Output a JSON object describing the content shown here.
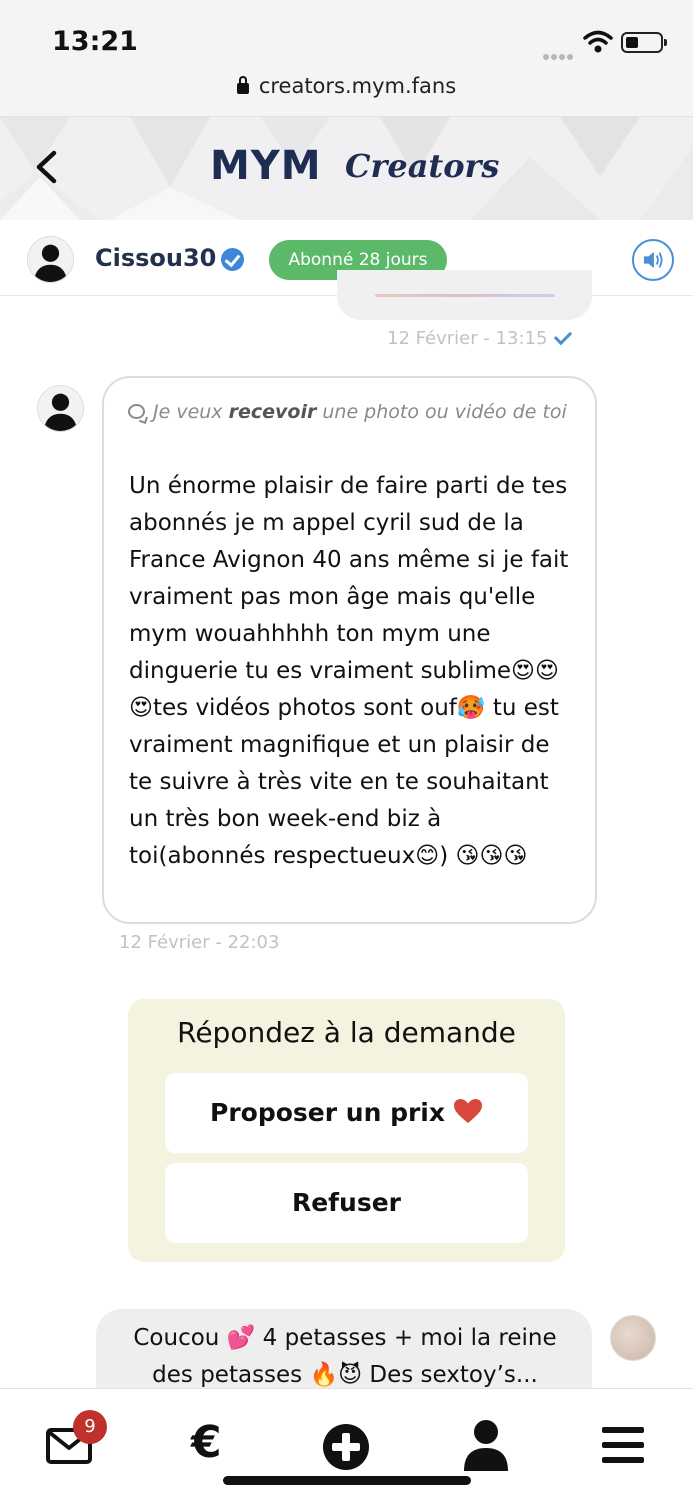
{
  "status_bar": {
    "time": "13:21"
  },
  "browser": {
    "url": "creators.mym.fans"
  },
  "header": {
    "logo_main": "MYM",
    "logo_sub": "Creators",
    "back_icon": "chevron-left-icon"
  },
  "profile": {
    "name": "Cissou30",
    "verified_icon": "verified-check-icon",
    "subscription_badge": "Abonné 28 jours",
    "sound_icon": "speaker-icon",
    "badge_color": "#5cb96a"
  },
  "chat": {
    "previous_timestamp": "12 Février - 13:15",
    "message": {
      "request_prefix": "Je veux ",
      "request_bold": "recevoir",
      "request_suffix": " une photo ou vidéo de toi",
      "text": "Un énorme plaisir de faire parti de tes abonnés je m appel cyril sud de la France Avignon 40 ans même si je fait vraiment pas mon âge mais qu'elle mym wouahhhhh ton mym une dinguerie tu es vraiment sublime😍😍😍tes vidéos photos sont ouf🥵 tu est vraiment magnifique et un plaisir de te suivre à très vite en te souhaitant un très bon week-end biz à toi(abonnés respectueux😊) 😘😘😘",
      "timestamp": "12 Février - 22:03"
    },
    "request_box": {
      "title": "Répondez à la demande",
      "propose_label": "Proposer un prix",
      "refuse_label": "Refuser",
      "heart_color": "#d9473f",
      "background": "#f3f3e0"
    },
    "next_message": {
      "text": "Coucou 💕 4 petasses + moi la reine des petasses 🔥😈 Des sextoy’s..."
    }
  },
  "bottom_nav": {
    "items": [
      "mail-icon",
      "euro-icon",
      "add-icon",
      "profile-icon",
      "menu-icon"
    ],
    "mail_badge": "9",
    "euro_label": "€",
    "badge_color": "#c0312b"
  }
}
